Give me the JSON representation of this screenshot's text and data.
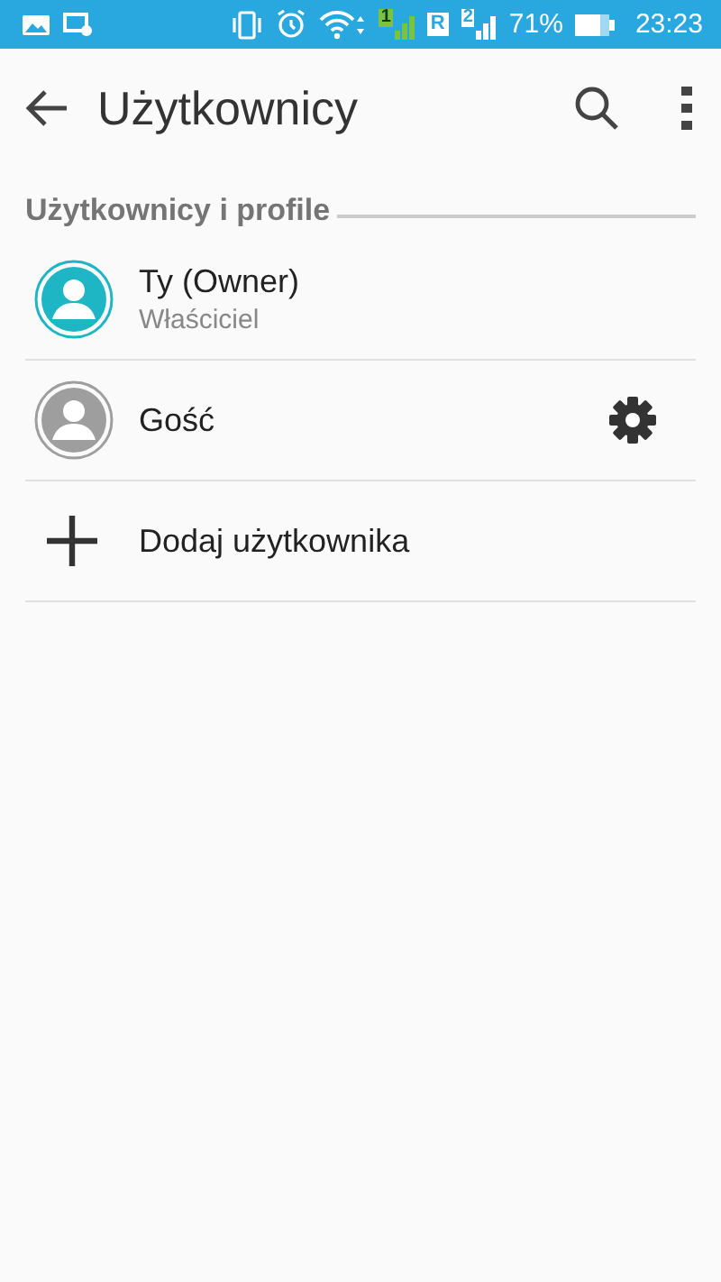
{
  "status_bar": {
    "sim1": "1",
    "roaming": "R",
    "sim2": "2",
    "battery": "71%",
    "time": "23:23"
  },
  "toolbar": {
    "title": "Użytkownicy"
  },
  "section": {
    "title": "Użytkownicy i profile"
  },
  "items": [
    {
      "kind": "user",
      "name": "Ty (Owner)",
      "subtitle": "Właściciel",
      "color": "#1eb5c5",
      "settings": false
    },
    {
      "kind": "user",
      "name": "Gość",
      "color": "#9e9e9e",
      "settings": true
    },
    {
      "kind": "add",
      "name": "Dodaj użytkownika"
    }
  ]
}
